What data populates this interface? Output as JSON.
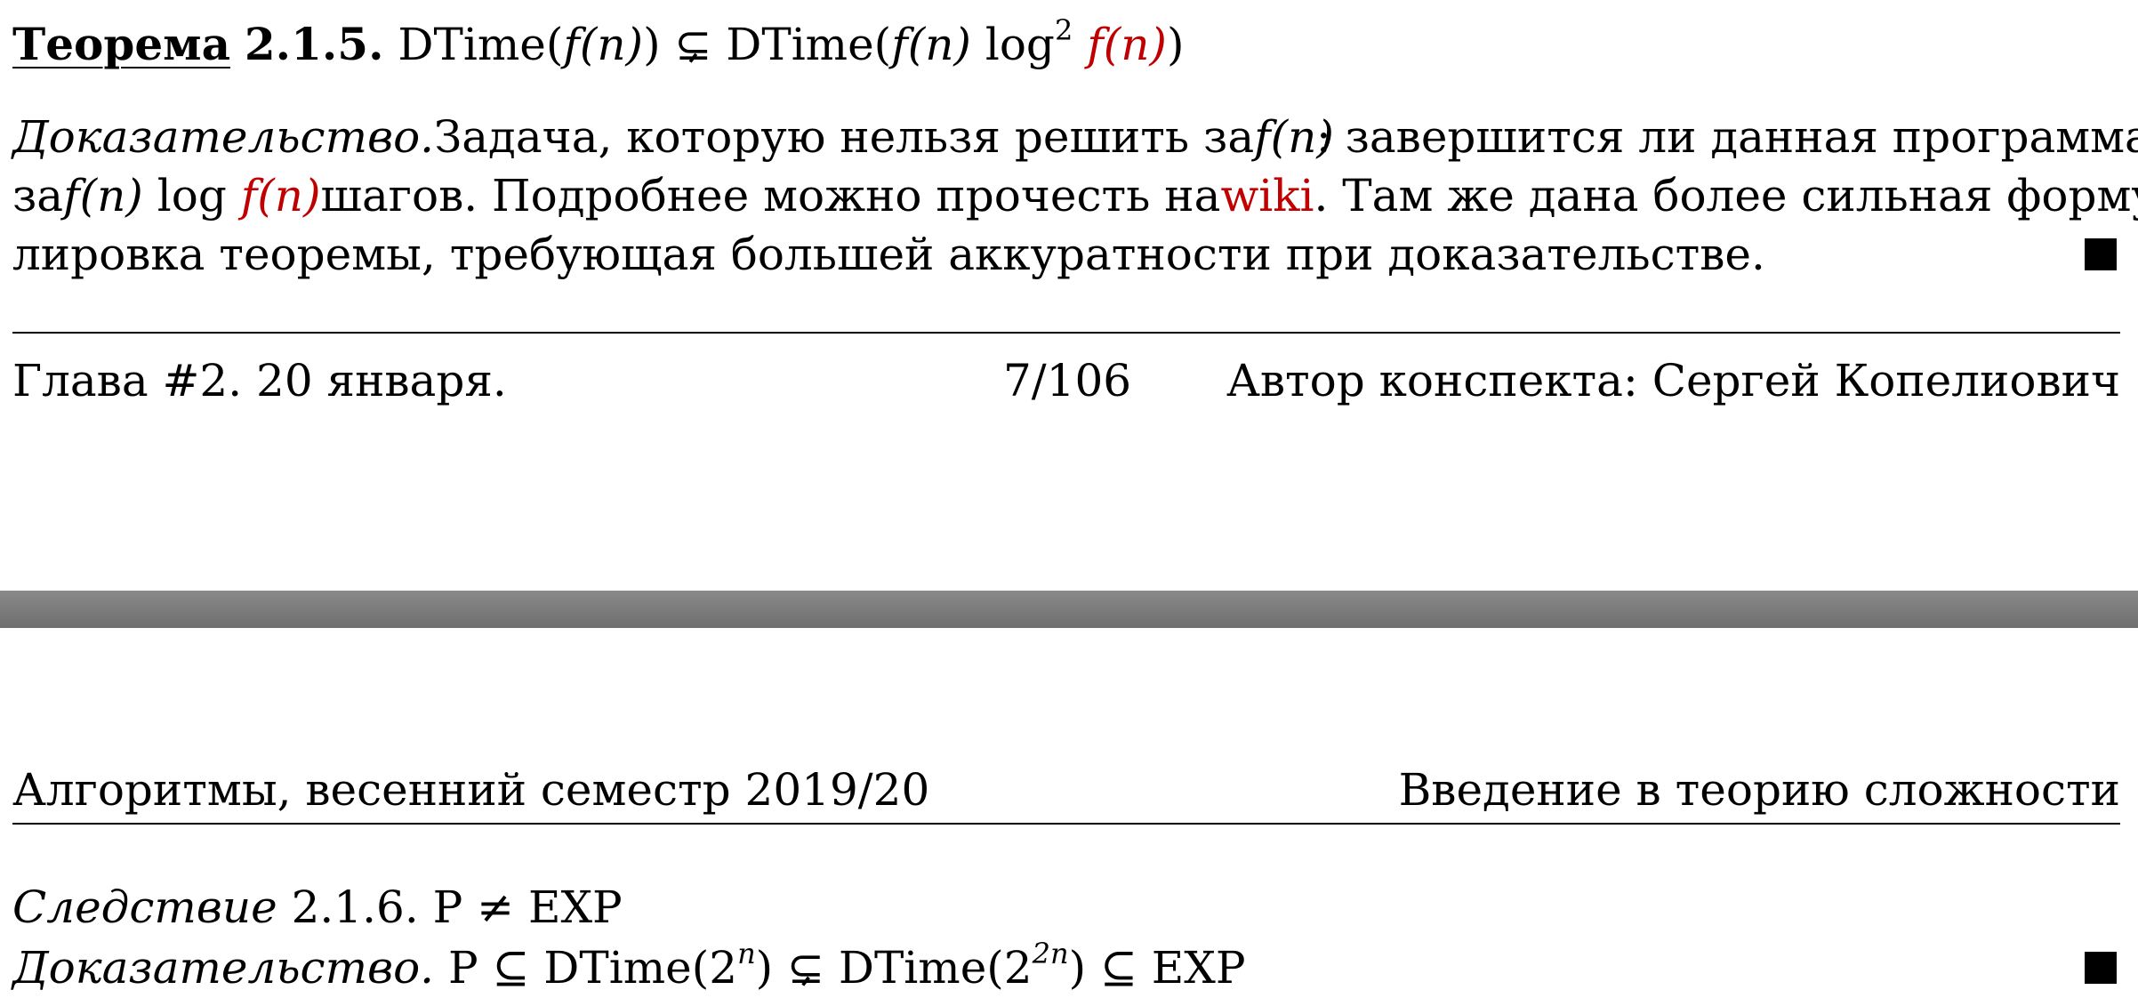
{
  "theorem": {
    "label": "Теорема",
    "number": "2.1.5.",
    "formula_left": "DTime(",
    "formula_f": "f",
    "formula_n": "(n)",
    "formula_mid": ") ⊊ DTime(",
    "formula_log": " log",
    "formula_sq": "2",
    "formula_red": "f(n)",
    "formula_close": ")"
  },
  "proof1": {
    "label": "Доказательство.",
    "line1_text": "Задача, которую нельзя решить за",
    "line1_math": "f(n)",
    "line1_rest": ": завершится ли данная программа",
    "line2_za": "за",
    "line2_math": "f(n)",
    "line2_log": "log",
    "line2_red": "f(n)",
    "line2_text": "шагов. Подробнее можно прочесть на",
    "line2_link": "wiki",
    "line2_rest": ". Там же дана более сильная форму-",
    "line3": "лировка теоремы, требующая большей аккуратности при доказательстве."
  },
  "footer": {
    "chapter": "Глава #2. 20 января.",
    "page": "7/106",
    "author": "Автор конспекта: Сергей Копелиович"
  },
  "header": {
    "course": "Алгоритмы, весенний семестр 2019/20",
    "topic": "Введение в теорию сложности"
  },
  "corollary": {
    "label": "Следствие",
    "number": "2.1.6.",
    "formula": "P ≠ EXP"
  },
  "proof2": {
    "label": "Доказательство.",
    "p1": "P ⊆ DTime(2",
    "exp1": "n",
    "p2": ") ⊊ DTime(2",
    "exp2": "2n",
    "p3": ") ⊆ EXP"
  }
}
